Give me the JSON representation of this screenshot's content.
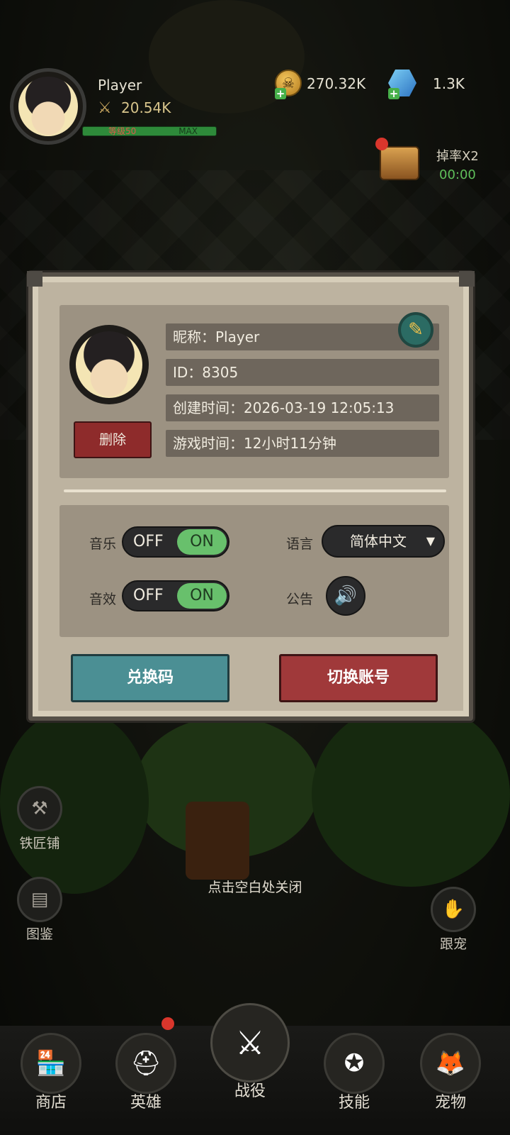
{
  "hud": {
    "player_name": "Player",
    "power": "20.54K",
    "level_text": "等级50",
    "level_max": "MAX",
    "gold": "270.32K",
    "gems": "1.3K",
    "drop_label": "掉率X2",
    "drop_timer": "00:00",
    "level_progress": 1.0
  },
  "dialog": {
    "nickname": "昵称：Player",
    "id": "ID：8305",
    "created": "创建时间：2026-03-19 12:05:13",
    "playtime": "游戏时间：12小时11分钟",
    "delete_label": "删除",
    "music_label": "音乐",
    "sfx_label": "音效",
    "language_label": "语言",
    "notice_label": "公告",
    "toggle_off": "OFF",
    "toggle_on": "ON",
    "music_state": "ON",
    "sfx_state": "ON",
    "language_value": "简体中文",
    "redeem_label": "兑换码",
    "switch_label": "切换账号"
  },
  "close_hint": "点击空白处关闭",
  "side": {
    "blacksmith": "铁匠铺",
    "codex": "图鉴",
    "follow_pet": "跟宠"
  },
  "nav": {
    "shop": "商店",
    "heroes": "英雄",
    "battle": "战役",
    "skills": "技能",
    "pets": "宠物"
  },
  "icons": {
    "sword": "⚔",
    "skull": "☠",
    "pencil": "✎",
    "speaker": "🔊",
    "hammer": "⚒",
    "book": "▤",
    "claw": "✋",
    "shop": "🏪",
    "helmet": "⛑",
    "battle": "⚔",
    "skillbook": "✪",
    "fox": "🦊",
    "arrow": "▼"
  },
  "colors": {
    "accent_green": "#68c06c",
    "danger_red": "#a0393a",
    "teal": "#4b8f94"
  }
}
